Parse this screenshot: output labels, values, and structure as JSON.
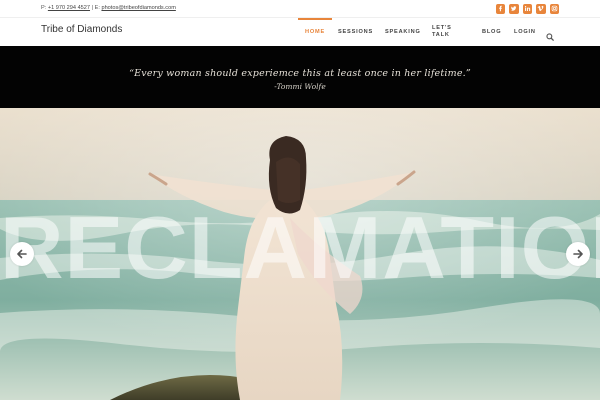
{
  "topbar": {
    "phone_prefix": "P:",
    "phone": "+1 970 294 4527",
    "separator": "|",
    "email_prefix": "E:",
    "email": "photos@tribeofdiamonds.com",
    "social_icons": [
      "facebook-icon",
      "twitter-icon",
      "linkedin-icon",
      "vimeo-icon",
      "instagram-icon"
    ]
  },
  "header": {
    "brand": "Tribe of Diamonds",
    "nav": {
      "home": "HOME",
      "sessions": "SESSIONS",
      "speaking": "SPEAKING",
      "lets": "LET'S",
      "talk": "TALK",
      "blog": "BLOG",
      "login": "LOGIN"
    },
    "search_icon": "search-icon"
  },
  "quote": {
    "text": "“Every woman should experiemce this at least once in her lifetime.”",
    "author": "-Tommi Wolfe"
  },
  "slider": {
    "title": "RECLAMATION",
    "prev_icon": "arrow-left-icon",
    "next_icon": "arrow-right-icon"
  },
  "colors": {
    "accent": "#e8853b",
    "quote_band": "#030303",
    "text": "#333333"
  }
}
